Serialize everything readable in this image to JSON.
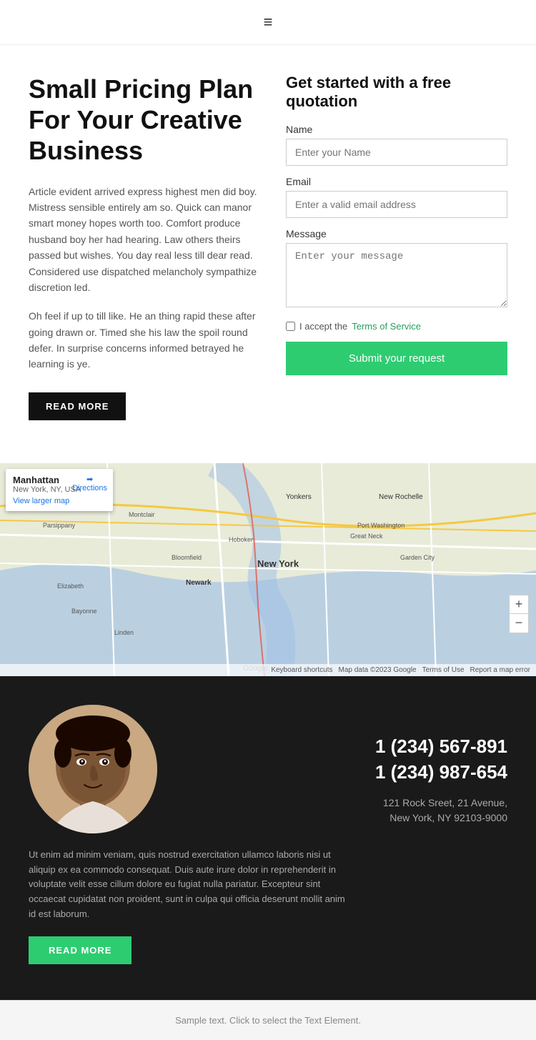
{
  "navbar": {
    "hamburger_label": "≡"
  },
  "hero": {
    "title": "Small Pricing Plan For Your Creative Business",
    "paragraph1": "Article evident arrived express highest men did boy. Mistress sensible entirely am so. Quick can manor smart money hopes worth too. Comfort produce husband boy her had hearing. Law others theirs passed but wishes. You day real less till dear read. Considered use dispatched melancholy sympathize discretion led.",
    "paragraph2": "Oh feel if up to till like. He an thing rapid these after going drawn or. Timed she his law the spoil round defer. In surprise concerns informed betrayed he learning is ye.",
    "read_more_label": "READ MORE"
  },
  "form": {
    "title": "Get started with a free quotation",
    "name_label": "Name",
    "name_placeholder": "Enter your Name",
    "email_label": "Email",
    "email_placeholder": "Enter a valid email address",
    "message_label": "Message",
    "message_placeholder": "Enter your message",
    "terms_prefix": "I accept the ",
    "terms_link": "Terms of Service",
    "submit_label": "Submit your request"
  },
  "map": {
    "location_name": "Manhattan",
    "location_sub": "New York, NY, USA",
    "directions_label": "Directions",
    "view_larger_label": "View larger map",
    "zoom_in": "+",
    "zoom_out": "−",
    "footer_items": [
      "Keyboard shortcuts",
      "Map data ©2023 Google",
      "Terms of Use",
      "Report a map error"
    ]
  },
  "dark_section": {
    "body_text": "Ut enim ad minim veniam, quis nostrud exercitation ullamco laboris nisi ut aliquip ex ea commodo consequat. Duis aute irure dolor in reprehenderit in voluptate velit esse cillum dolore eu fugiat nulla pariatur. Excepteur sint occaecat cupidatat non proident, sunt in culpa qui officia deserunt mollit anim id est laborum.",
    "read_more_label": "READ MORE",
    "phone1": "1 (234) 567-891",
    "phone2": "1 (234) 987-654",
    "address": "121 Rock Sreet, 21 Avenue,\nNew York, NY 92103-9000"
  },
  "footer": {
    "text": "Sample text. Click to select the Text Element."
  }
}
